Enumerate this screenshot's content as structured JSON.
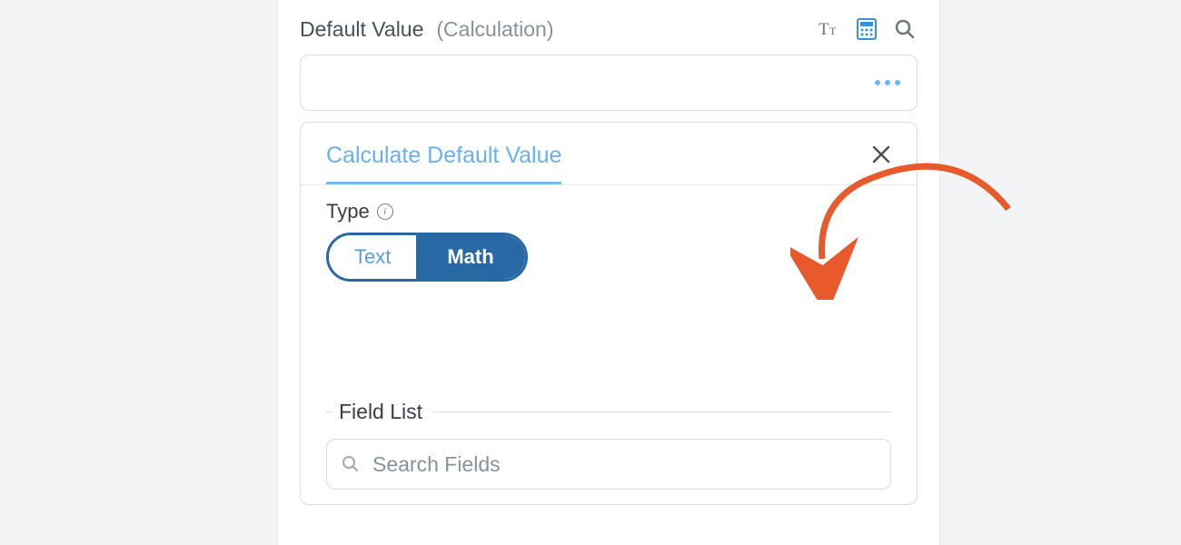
{
  "header": {
    "label": "Default Value",
    "sublabel": "(Calculation)"
  },
  "calc_panel": {
    "title": "Calculate Default Value",
    "type_label": "Type",
    "toggle": {
      "text_label": "Text",
      "math_label": "Math"
    },
    "fieldset_label": "Field List",
    "search_placeholder": "Search Fields"
  }
}
